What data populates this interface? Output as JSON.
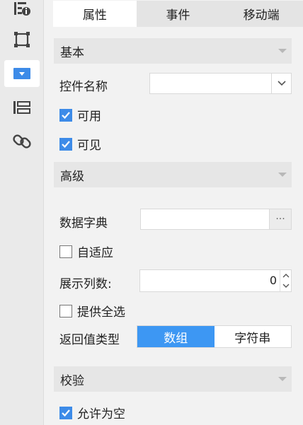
{
  "sidebar": {
    "items": [
      {
        "icon": "widget-info-icon",
        "active": false
      },
      {
        "icon": "frame-icon",
        "active": false
      },
      {
        "icon": "dropdown-widget-icon",
        "active": true
      },
      {
        "icon": "layout-icon",
        "active": false
      },
      {
        "icon": "link-icon",
        "active": false
      }
    ]
  },
  "tabs": [
    "属性",
    "事件",
    "移动端"
  ],
  "sections": {
    "basic": "基本",
    "advanced": "高级",
    "validation": "校验"
  },
  "basic": {
    "widget_name_label": "控件名称",
    "widget_name_value": "",
    "usable_label": "可用",
    "usable_checked": true,
    "visible_label": "可见",
    "visible_checked": true
  },
  "advanced": {
    "dictionary_label": "数据字典",
    "dictionary_value": "",
    "dictionary_button": "···",
    "adaptive_label": "自适应",
    "adaptive_checked": false,
    "columns_label": "展示列数:",
    "columns_value": "0",
    "select_all_label": "提供全选",
    "select_all_checked": false,
    "return_type_label": "返回值类型",
    "return_type_options": [
      "数组",
      "字符串"
    ],
    "return_type_selected": "数组"
  },
  "validation": {
    "allow_empty_label": "允许为空",
    "allow_empty_checked": true
  },
  "colors": {
    "accent": "#3d97f3",
    "checkbox": "#3d8be8"
  }
}
